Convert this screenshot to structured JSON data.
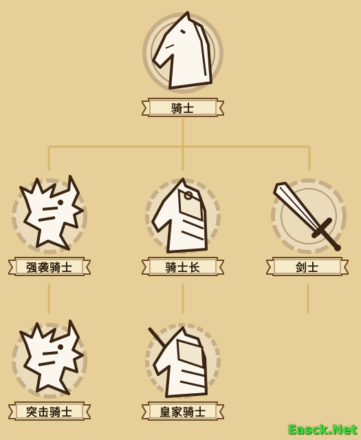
{
  "tree": {
    "root": {
      "label": "骑士",
      "icon": "horse-icon"
    },
    "tier2": [
      {
        "label": "强袭骑士",
        "icon": "dragon-icon"
      },
      {
        "label": "骑士长",
        "icon": "armored-horse-icon"
      },
      {
        "label": "剑士",
        "icon": "sword-icon"
      }
    ],
    "tier3": [
      {
        "label": "突击骑士",
        "icon": "dragon-icon"
      },
      {
        "label": "皇家骑士",
        "icon": "unicorn-knight-icon"
      }
    ]
  },
  "colors": {
    "background": "#e6cf98",
    "connector": "#d8b468",
    "banner_fill": "#f3e2b5",
    "banner_border": "#6b4a25",
    "medal_ring": "#c8ae86",
    "ink": "#3b2412"
  },
  "watermark": "Easck.Net"
}
